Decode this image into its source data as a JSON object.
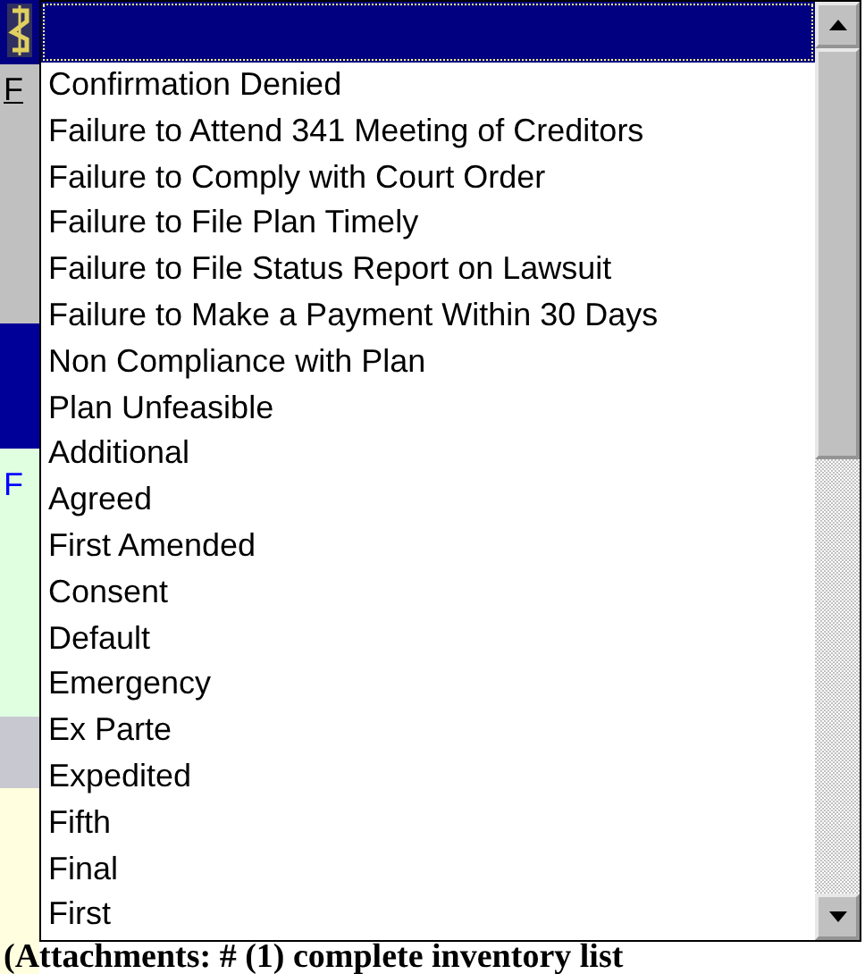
{
  "background": {
    "letters": [
      "F",
      "F"
    ],
    "caption": "(Attachments: # (1) complete inventory list"
  },
  "dropdown": {
    "items": [
      {
        "selected": true
      },
      {
        "label": "Confirmation Denied",
        "selected": false
      },
      {
        "label": "Failure to Attend 341 Meeting of Creditors",
        "selected": false
      },
      {
        "label": "Failure to Comply with Court Order",
        "selected": false
      },
      {
        "label": "Failure to File Plan Timely",
        "selected": false
      },
      {
        "label": "Failure to File Status Report on Lawsuit",
        "selected": false
      },
      {
        "label": "Failure to Make a Payment Within 30 Days",
        "selected": false
      },
      {
        "label": "Non Compliance with Plan",
        "selected": false
      },
      {
        "label": "Plan Unfeasible",
        "selected": false
      },
      {
        "label": "Additional",
        "selected": false
      },
      {
        "label": "Agreed",
        "selected": false
      },
      {
        "label": "First Amended",
        "selected": false
      },
      {
        "label": "Consent",
        "selected": false
      },
      {
        "label": "Default",
        "selected": false
      },
      {
        "label": "Emergency",
        "selected": false
      },
      {
        "label": "Ex Parte",
        "selected": false
      },
      {
        "label": "Expedited",
        "selected": false
      },
      {
        "label": "Fifth",
        "selected": false
      },
      {
        "label": "Final",
        "selected": false
      },
      {
        "label": "First",
        "selected": false
      }
    ]
  }
}
